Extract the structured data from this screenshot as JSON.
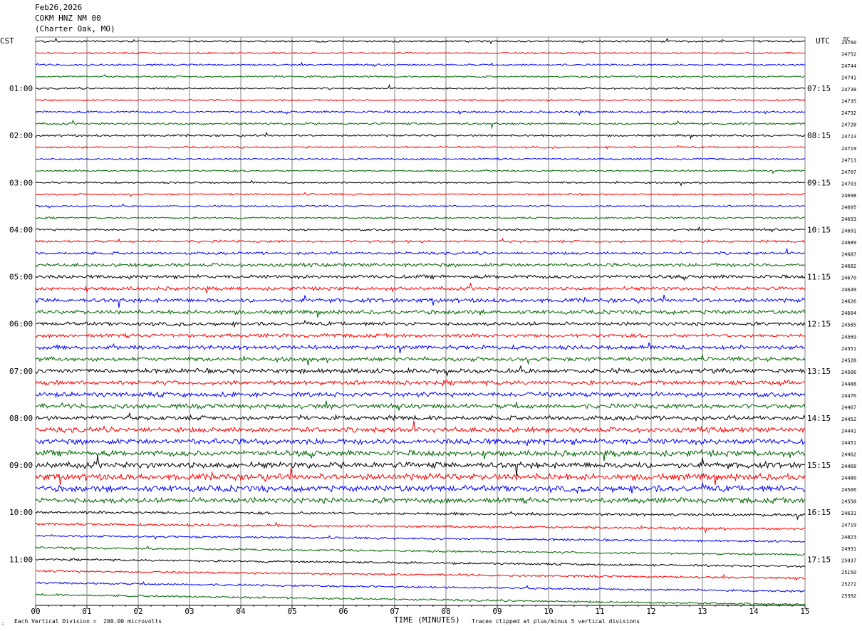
{
  "header": {
    "date": "Feb26,2026",
    "station": "COKM HNZ NM 00",
    "location": "(Charter Oak, MO)"
  },
  "left_timezone": "CST",
  "right_timezone": "UTC",
  "dc_label": "DC",
  "footer": {
    "left_note": "Each Vertical Division =  200.00 microvolts",
    "xlabel": "TIME (MINUTES)",
    "right_note": "Traces clipped at plus/minus 5 vertical divisions"
  },
  "colors": {
    "trace_cycle": [
      "#000000",
      "#ff0000",
      "#0000ff",
      "#006600"
    ],
    "grid": "#808080"
  },
  "chart_data": {
    "type": "line",
    "xlabel": "TIME (MINUTES)",
    "xlim": [
      0,
      15
    ],
    "x_ticks": [
      "00",
      "01",
      "02",
      "03",
      "04",
      "05",
      "06",
      "07",
      "08",
      "09",
      "10",
      "11",
      "12",
      "13",
      "14",
      "15"
    ],
    "traces_per_hour": 4,
    "minutes_per_trace": 15,
    "local_hour_labels": [
      "01:00",
      "02:00",
      "03:00",
      "04:00",
      "05:00",
      "06:00",
      "07:00",
      "08:00",
      "09:00",
      "10:00",
      "11:00"
    ],
    "utc_labels": [
      "07:15",
      "08:15",
      "09:15",
      "10:15",
      "11:15",
      "12:15",
      "13:15",
      "14:15",
      "15:15",
      "16:15",
      "17:15"
    ],
    "dc_values": [
      "24760",
      "24752",
      "24744",
      "24741",
      "24738",
      "24735",
      "24732",
      "24728",
      "24723",
      "24719",
      "24713",
      "24707",
      "24703",
      "24698",
      "24695",
      "24693",
      "24691",
      "24689",
      "24687",
      "24682",
      "24670",
      "24649",
      "24626",
      "24604",
      "24585",
      "24569",
      "24551",
      "24528",
      "24506",
      "24488",
      "24476",
      "24467",
      "24452",
      "24441",
      "24451",
      "24462",
      "24468",
      "24480",
      "24506",
      "24558",
      "24631",
      "24719",
      "24823",
      "24931",
      "25037",
      "25150",
      "25272",
      "25392"
    ],
    "noise_levels": [
      1,
      1,
      1,
      1,
      1,
      1,
      1.2,
      1.2,
      1.2,
      1,
      1,
      1,
      1,
      1,
      1,
      1,
      1.2,
      1.3,
      1.5,
      2,
      2,
      2,
      2.3,
      2.3,
      2,
      2,
      2.3,
      2.3,
      2.6,
      2.5,
      2.6,
      2.6,
      2.6,
      2.8,
      3.2,
      3.2,
      3.4,
      3.6,
      3.4,
      3,
      1.6,
      1.4,
      1.2,
      1.2,
      1.2,
      1.2,
      1.2,
      1.2
    ],
    "drift": [
      0,
      0,
      0,
      0,
      0,
      0,
      0,
      0,
      0,
      0,
      0,
      0,
      0,
      0,
      0,
      0,
      0,
      0,
      0,
      0,
      0,
      0,
      0,
      0,
      0,
      0,
      0,
      0,
      0,
      0,
      0,
      0,
      0,
      0,
      0,
      0,
      0,
      0,
      0,
      0,
      4,
      7,
      8,
      10,
      10,
      10,
      12,
      14
    ]
  }
}
